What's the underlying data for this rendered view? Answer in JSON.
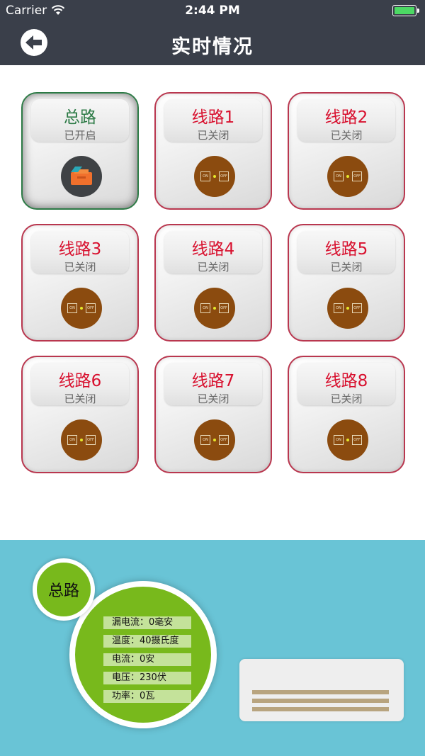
{
  "status_bar": {
    "carrier": "Carrier",
    "time": "2:44 PM"
  },
  "nav": {
    "title": "实时情况",
    "back_icon": "back-arrow-icon"
  },
  "lines": [
    {
      "name": "总路",
      "state": "已开启",
      "on": true
    },
    {
      "name": "线路1",
      "state": "已关闭",
      "on": false
    },
    {
      "name": "线路2",
      "state": "已关闭",
      "on": false
    },
    {
      "name": "线路3",
      "state": "已关闭",
      "on": false
    },
    {
      "name": "线路4",
      "state": "已关闭",
      "on": false
    },
    {
      "name": "线路5",
      "state": "已关闭",
      "on": false
    },
    {
      "name": "线路6",
      "state": "已关闭",
      "on": false
    },
    {
      "name": "线路7",
      "state": "已关闭",
      "on": false
    },
    {
      "name": "线路8",
      "state": "已关闭",
      "on": false
    }
  ],
  "switch_labels": {
    "on": "ON",
    "off": "OFF"
  },
  "panel": {
    "title": "总路",
    "metrics": [
      {
        "label": "漏电流：0毫安"
      },
      {
        "label": "温度：40摄氏度"
      },
      {
        "label": "电流：0安"
      },
      {
        "label": "电压：230伏"
      },
      {
        "label": "功率：0瓦"
      }
    ]
  },
  "colors": {
    "navbar": "#3a3f4a",
    "off_text": "#d8102e",
    "on_text": "#2c7a45",
    "knob_brown": "#8b4b0f",
    "panel_bg": "#69c4d6",
    "green": "#78b91c"
  }
}
